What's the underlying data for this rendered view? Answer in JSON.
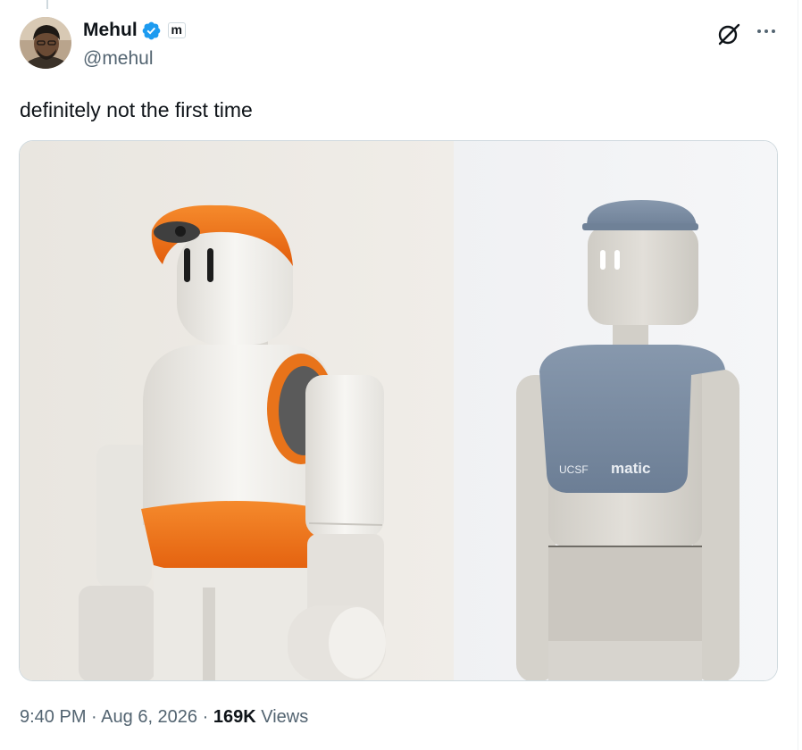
{
  "author": {
    "display_name": "Mehul",
    "handle": "@mehul",
    "verified": true,
    "affiliate_badge": "m",
    "verified_color": "#1d9bf0"
  },
  "tweet": {
    "text": "definitely not the first time"
  },
  "media": {
    "right_image_logos": [
      "UCSF",
      "matic"
    ]
  },
  "meta": {
    "time": "9:40 PM",
    "separator": "·",
    "date": "Aug 6, 2026",
    "views_count": "169K",
    "views_label": "Views"
  },
  "colors": {
    "text_primary": "#0f1419",
    "text_secondary": "#536471",
    "border": "#cfd9de",
    "robot_orange": "#f07a1a",
    "robot_slate": "#7c8ea3"
  }
}
